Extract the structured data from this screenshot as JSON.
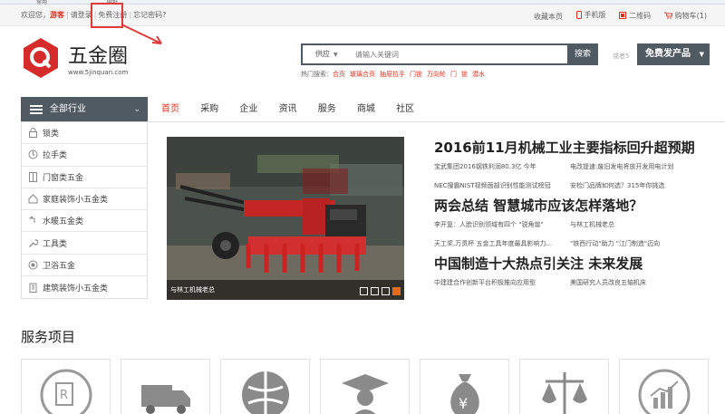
{
  "browser_strip": {
    "left": "常用",
    "mid": "网址"
  },
  "topbar": {
    "welcome": "欢迎您，",
    "guest": "游客",
    "login": "请登录",
    "register": "免费注册",
    "forgot": "忘记密码?",
    "right": [
      {
        "label": "收藏本页",
        "icon": ""
      },
      {
        "label": "手机版",
        "icon": "phone-icon"
      },
      {
        "label": "二维码",
        "icon": "qrcode-icon"
      },
      {
        "label": "购物车(1)",
        "icon": "cart-icon"
      }
    ]
  },
  "logo": {
    "name": "五金圈",
    "domain": "www.5jinquan.com"
  },
  "search": {
    "category": "供应",
    "placeholder": "请输入关键词",
    "button": "搜索",
    "or_label": "或者5",
    "hot_label": "热门搜索：",
    "hot_keywords": [
      "合页",
      "玻璃合页",
      "抽屉拉手",
      "门锁",
      "万向轮",
      "门",
      "锁",
      "潜水"
    ]
  },
  "publish_button": "免费发产品",
  "nav": {
    "all_categories": "全部行业",
    "items": [
      "首页",
      "采购",
      "企业",
      "资讯",
      "服务",
      "商城",
      "社区"
    ],
    "active_index": 0
  },
  "categories": [
    {
      "label": "锁类",
      "icon": "lock-icon"
    },
    {
      "label": "拉手类",
      "icon": "handle-icon"
    },
    {
      "label": "门窗类五金",
      "icon": "door-icon"
    },
    {
      "label": "家庭装饰小五金类",
      "icon": "home-icon"
    },
    {
      "label": "水暖五金类",
      "icon": "faucet-icon"
    },
    {
      "label": "工具类",
      "icon": "wrench-icon"
    },
    {
      "label": "卫浴五金",
      "icon": "bath-icon"
    },
    {
      "label": "建筑装饰小五金类",
      "icon": "building-icon"
    }
  ],
  "slider": {
    "caption": "与林工机械老总",
    "slide_count": 4,
    "active_slide": 4
  },
  "news": [
    {
      "headline": "2016前11月机械工业主要指标回升超预期",
      "items": [
        [
          "宝武集团2016钢铁利润80.3亿 今年",
          "电改提速:废旧发电将放开发用电计划"
        ],
        [
          "NEC搜霸NIST视频面部识别性能测试榜冠",
          "安检门品牌如何选？315年你挑选"
        ]
      ]
    },
    {
      "headline": "两会总结 智慧城市应该怎样落地？",
      "items": [
        [
          "李开复：人脸识别领域有四个 \"锐角兽\"",
          "与林工机械老总"
        ],
        [
          "天工奖,万贯杯 五金工具年度最具影响力...",
          "\"铁西行动\"助力 \"江门制造\"迈向"
        ]
      ]
    },
    {
      "headline": "中国制造十大热点引关注 未来发展",
      "items": [
        [
          "中建建合作创新平台积极推向应用型",
          "美国研究人员改良五轴机床"
        ]
      ]
    }
  ],
  "services": {
    "title": "服务项目",
    "icons": [
      "trademark-icon",
      "truck-icon",
      "globe-icon",
      "graduate-icon",
      "money-bag-icon",
      "scales-icon",
      "chart-icon"
    ]
  },
  "colors": {
    "accent_red": "#dd3333",
    "dark_gray": "#505a63",
    "slider_active": "#e46c1e"
  }
}
